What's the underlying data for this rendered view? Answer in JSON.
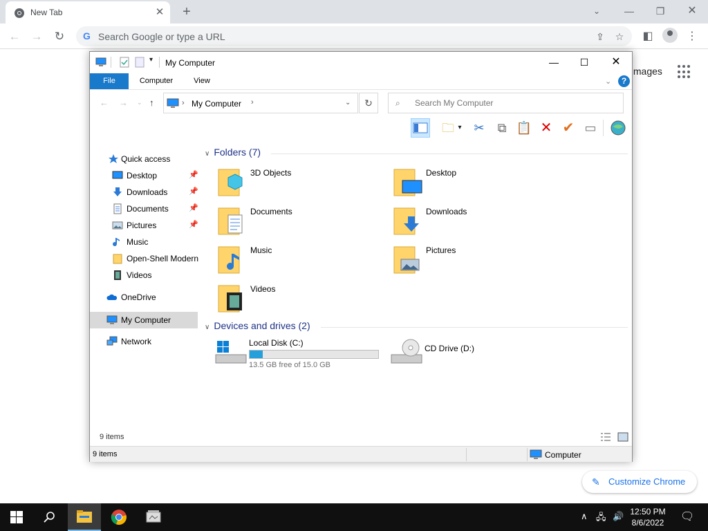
{
  "chrome": {
    "tab_title": "New Tab",
    "omnibox_placeholder": "Search Google or type a URL",
    "images_link": "Images",
    "customize_label": "Customize Chrome"
  },
  "explorer": {
    "title": "My Computer",
    "ribbon_tabs": [
      "File",
      "Computer",
      "View"
    ],
    "address": "My Computer",
    "search_placeholder": "Search My Computer",
    "nav": [
      {
        "label": "Quick access",
        "icon": "star-icon"
      },
      {
        "label": "Desktop",
        "icon": "desktop-icon",
        "pinned": true
      },
      {
        "label": "Downloads",
        "icon": "download-icon",
        "pinned": true
      },
      {
        "label": "Documents",
        "icon": "document-icon",
        "pinned": true
      },
      {
        "label": "Pictures",
        "icon": "pictures-icon",
        "pinned": true
      },
      {
        "label": "Music",
        "icon": "music-icon"
      },
      {
        "label": "Open-Shell Modern",
        "icon": "folder-icon"
      },
      {
        "label": "Videos",
        "icon": "video-icon"
      },
      {
        "label": "OneDrive",
        "icon": "cloud-icon"
      },
      {
        "label": "My Computer",
        "icon": "computer-icon",
        "selected": true
      },
      {
        "label": "Network",
        "icon": "network-icon"
      }
    ],
    "folders_header": "Folders (7)",
    "folders": [
      "3D Objects",
      "Desktop",
      "Documents",
      "Downloads",
      "Music",
      "Pictures",
      "Videos"
    ],
    "devices_header": "Devices and drives (2)",
    "drives": [
      {
        "name": "Local Disk (C:)",
        "free": "13.5 GB free of 15.0 GB",
        "used_fraction": 0.1
      },
      {
        "name": "CD Drive (D:)"
      }
    ],
    "item_count": "9 items",
    "status_left": "9 items",
    "status_right": "Computer"
  },
  "taskbar": {
    "time": "12:50 PM",
    "date": "8/6/2022"
  },
  "colors": {
    "accent": "#1979ca",
    "folder": "#ffd56b",
    "drive_fill": "#26a0da",
    "taskbar": "#101010"
  }
}
